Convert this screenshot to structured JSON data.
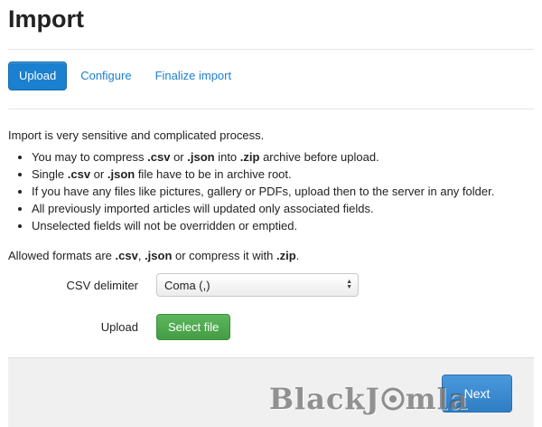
{
  "page": {
    "title": "Import"
  },
  "tabs": [
    {
      "label": "Upload",
      "active": true
    },
    {
      "label": "Configure",
      "active": false
    },
    {
      "label": "Finalize import",
      "active": false
    }
  ],
  "content": {
    "intro": "Import is very sensitive and complicated process.",
    "bullets": [
      [
        "You may to compress ",
        ".csv",
        " or ",
        ".json",
        " into ",
        ".zip",
        " archive before upload."
      ],
      [
        "Single ",
        ".csv",
        " or ",
        ".json",
        " file have to be in archive root."
      ],
      [
        "If you have any files like pictures, gallery or PDFs, upload then to the server in any folder."
      ],
      [
        "All previously imported articles will updated only associated fields."
      ],
      [
        "Unselected fields will not be overridden or emptied."
      ]
    ],
    "formats": [
      "Allowed formats are ",
      ".csv",
      ", ",
      ".json",
      " or compress it with ",
      ".zip",
      "."
    ]
  },
  "form": {
    "csv_delimiter_label": "CSV delimiter",
    "csv_delimiter_value": "Coma (,)",
    "upload_label": "Upload",
    "select_file_label": "Select file"
  },
  "footer": {
    "next_label": "Next"
  },
  "watermark": {
    "part1": "BlackJ",
    "part2": "mla"
  },
  "colors": {
    "primary": "#1a80cf",
    "success": "#5cb85c",
    "footer_bg": "#f0f0f0"
  }
}
